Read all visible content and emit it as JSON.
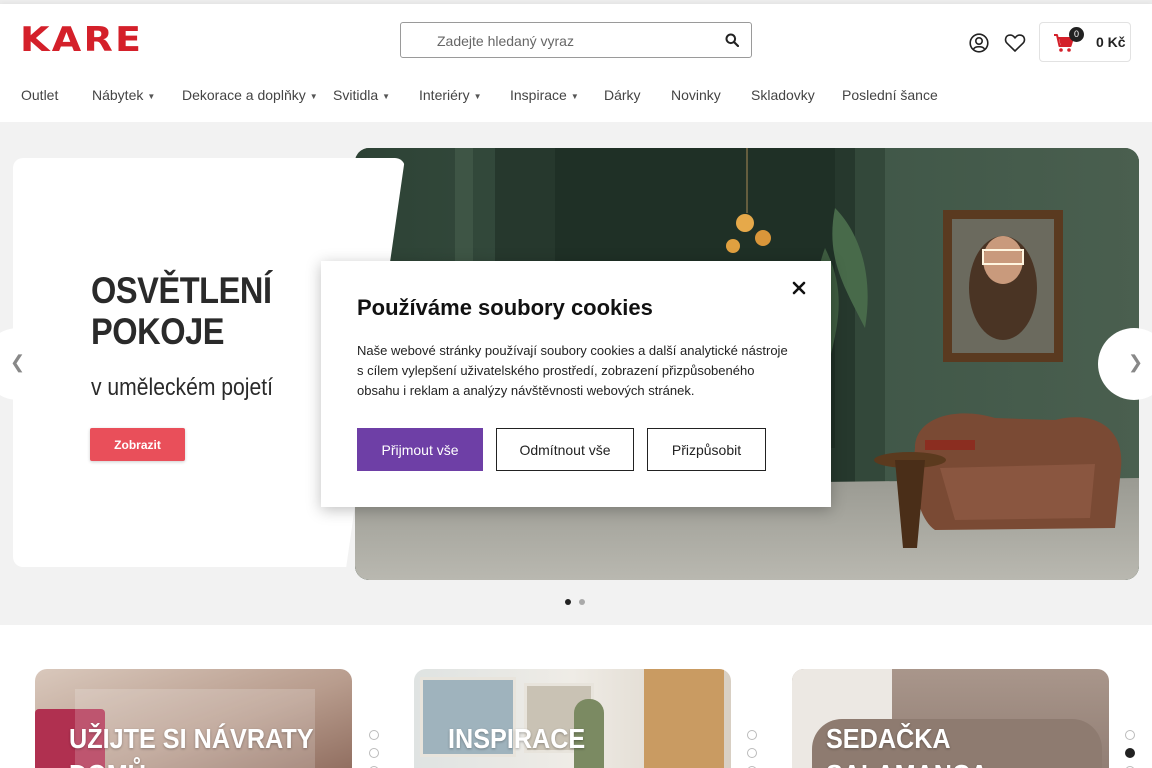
{
  "header": {
    "logo": "KARE",
    "search_placeholder": "Zadejte hledaný vyraz",
    "cart_count": "0",
    "cart_total": "0 Kč"
  },
  "nav": {
    "items": [
      {
        "label": "Outlet",
        "dropdown": false
      },
      {
        "label": "Nábytek",
        "dropdown": true
      },
      {
        "label": "Dekorace a doplňky",
        "dropdown": true
      },
      {
        "label": "Svitidla",
        "dropdown": true
      },
      {
        "label": "Interiéry",
        "dropdown": true
      },
      {
        "label": "Inspirace",
        "dropdown": true
      },
      {
        "label": "Dárky",
        "dropdown": false
      },
      {
        "label": "Novinky",
        "dropdown": false
      },
      {
        "label": "Skladovky",
        "dropdown": false
      },
      {
        "label": "Poslední šance",
        "dropdown": false
      }
    ]
  },
  "hero": {
    "title": "OSVĚTLENÍ POKOJE",
    "subtitle": "v uměleckém pojetí",
    "button_label": "Zobrazit",
    "prev_arrow": "❮",
    "next_arrow": "❯",
    "slide_count": 2,
    "active_slide": 0
  },
  "cookie_modal": {
    "title": "Používáme soubory cookies",
    "text": "Naše webové stránky používají soubory cookies a další analytické nástroje s cílem vylepšení uživatelského prostředí, zobrazení přizpůsobeného obsahu i reklam a analýzy návštěvnosti webových stránek.",
    "accept_label": "Přijmout vše",
    "reject_label": "Odmítnout vše",
    "customize_label": "Přizpůsobit"
  },
  "promos": [
    {
      "title_line1": "UŽIJTE SI NÁVRATY",
      "title_line2": "DOMŮ"
    },
    {
      "title_line1": "",
      "title_line2": "INSPIRACE"
    },
    {
      "title_line1": "SEDAČKA",
      "title_line2": "SALAMANCA"
    }
  ],
  "colors": {
    "brand": "#d4202a",
    "hero_button": "#e94f5a",
    "accept_button": "#6e3fa6"
  }
}
